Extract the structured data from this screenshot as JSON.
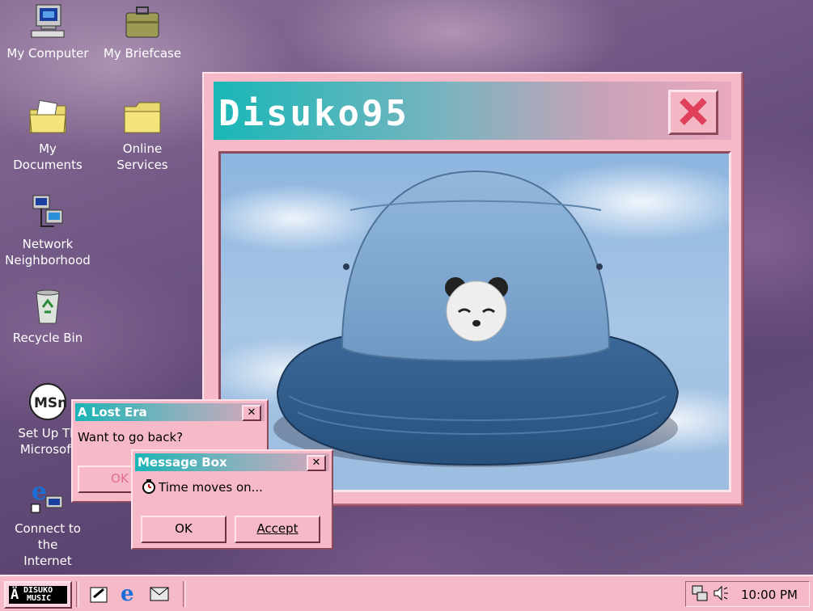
{
  "desktop": {
    "icons": [
      {
        "label": "My Computer",
        "icon": "computer-icon"
      },
      {
        "label": "My Briefcase",
        "icon": "briefcase-icon"
      },
      {
        "label": "My Documents",
        "icon": "documents-folder-icon"
      },
      {
        "label": "Online Services",
        "icon": "folder-icon"
      },
      {
        "label": "Network Neighborhood",
        "icon": "network-icon"
      },
      {
        "label": "Recycle Bin",
        "icon": "recycle-bin-icon"
      },
      {
        "label": "Set Up The Microsoft",
        "icon": "msn-icon"
      },
      {
        "label": "Connect to the Internet",
        "icon": "internet-explorer-icon"
      }
    ],
    "icon_lines": {
      "my_computer": "My Computer",
      "my_briefcase": "My Briefcase",
      "my_documents": "My Documents",
      "online_services_1": "Online",
      "online_services_2": "Services",
      "network_1": "Network",
      "network_2": "Neighborhood",
      "recycle_bin": "Recycle Bin",
      "setup_1": "Set Up Th",
      "setup_2": "Microsoft",
      "connect_1": "Connect to the",
      "connect_2": "Internet",
      "msn_logo": "MSn"
    }
  },
  "main_window": {
    "title": "Disuko95",
    "close_glyph": "X",
    "image": {
      "subject": "denim bucket hat with embroidered panda",
      "colors": {
        "crown": "#7fa8cf",
        "brim": "#34608f",
        "sky": "#9cbde0"
      }
    }
  },
  "dialogs": {
    "lost_era": {
      "title": "A Lost Era",
      "message": "Want to go back?",
      "ok_label": "OK",
      "close_glyph": "✕"
    },
    "message_box": {
      "title": "Message Box",
      "message": "Time moves on...",
      "icon": "timer-icon",
      "ok_label": "OK",
      "accept_label": "Accept",
      "close_glyph": "✕"
    }
  },
  "taskbar": {
    "start_logo_line1": "DISUKO",
    "start_logo_line2": "MUSIC",
    "quick_launch": [
      "show-desktop-icon",
      "internet-explorer-icon",
      "outlook-icon"
    ],
    "tray_icons": [
      "network-tray-icon",
      "volume-icon"
    ],
    "clock": "10:00 PM"
  },
  "colors": {
    "accent_teal": "#19b7b7",
    "window_pink": "#f5b9c8",
    "close_red": "#e0405a",
    "desktop_purple": "#6e5582"
  }
}
